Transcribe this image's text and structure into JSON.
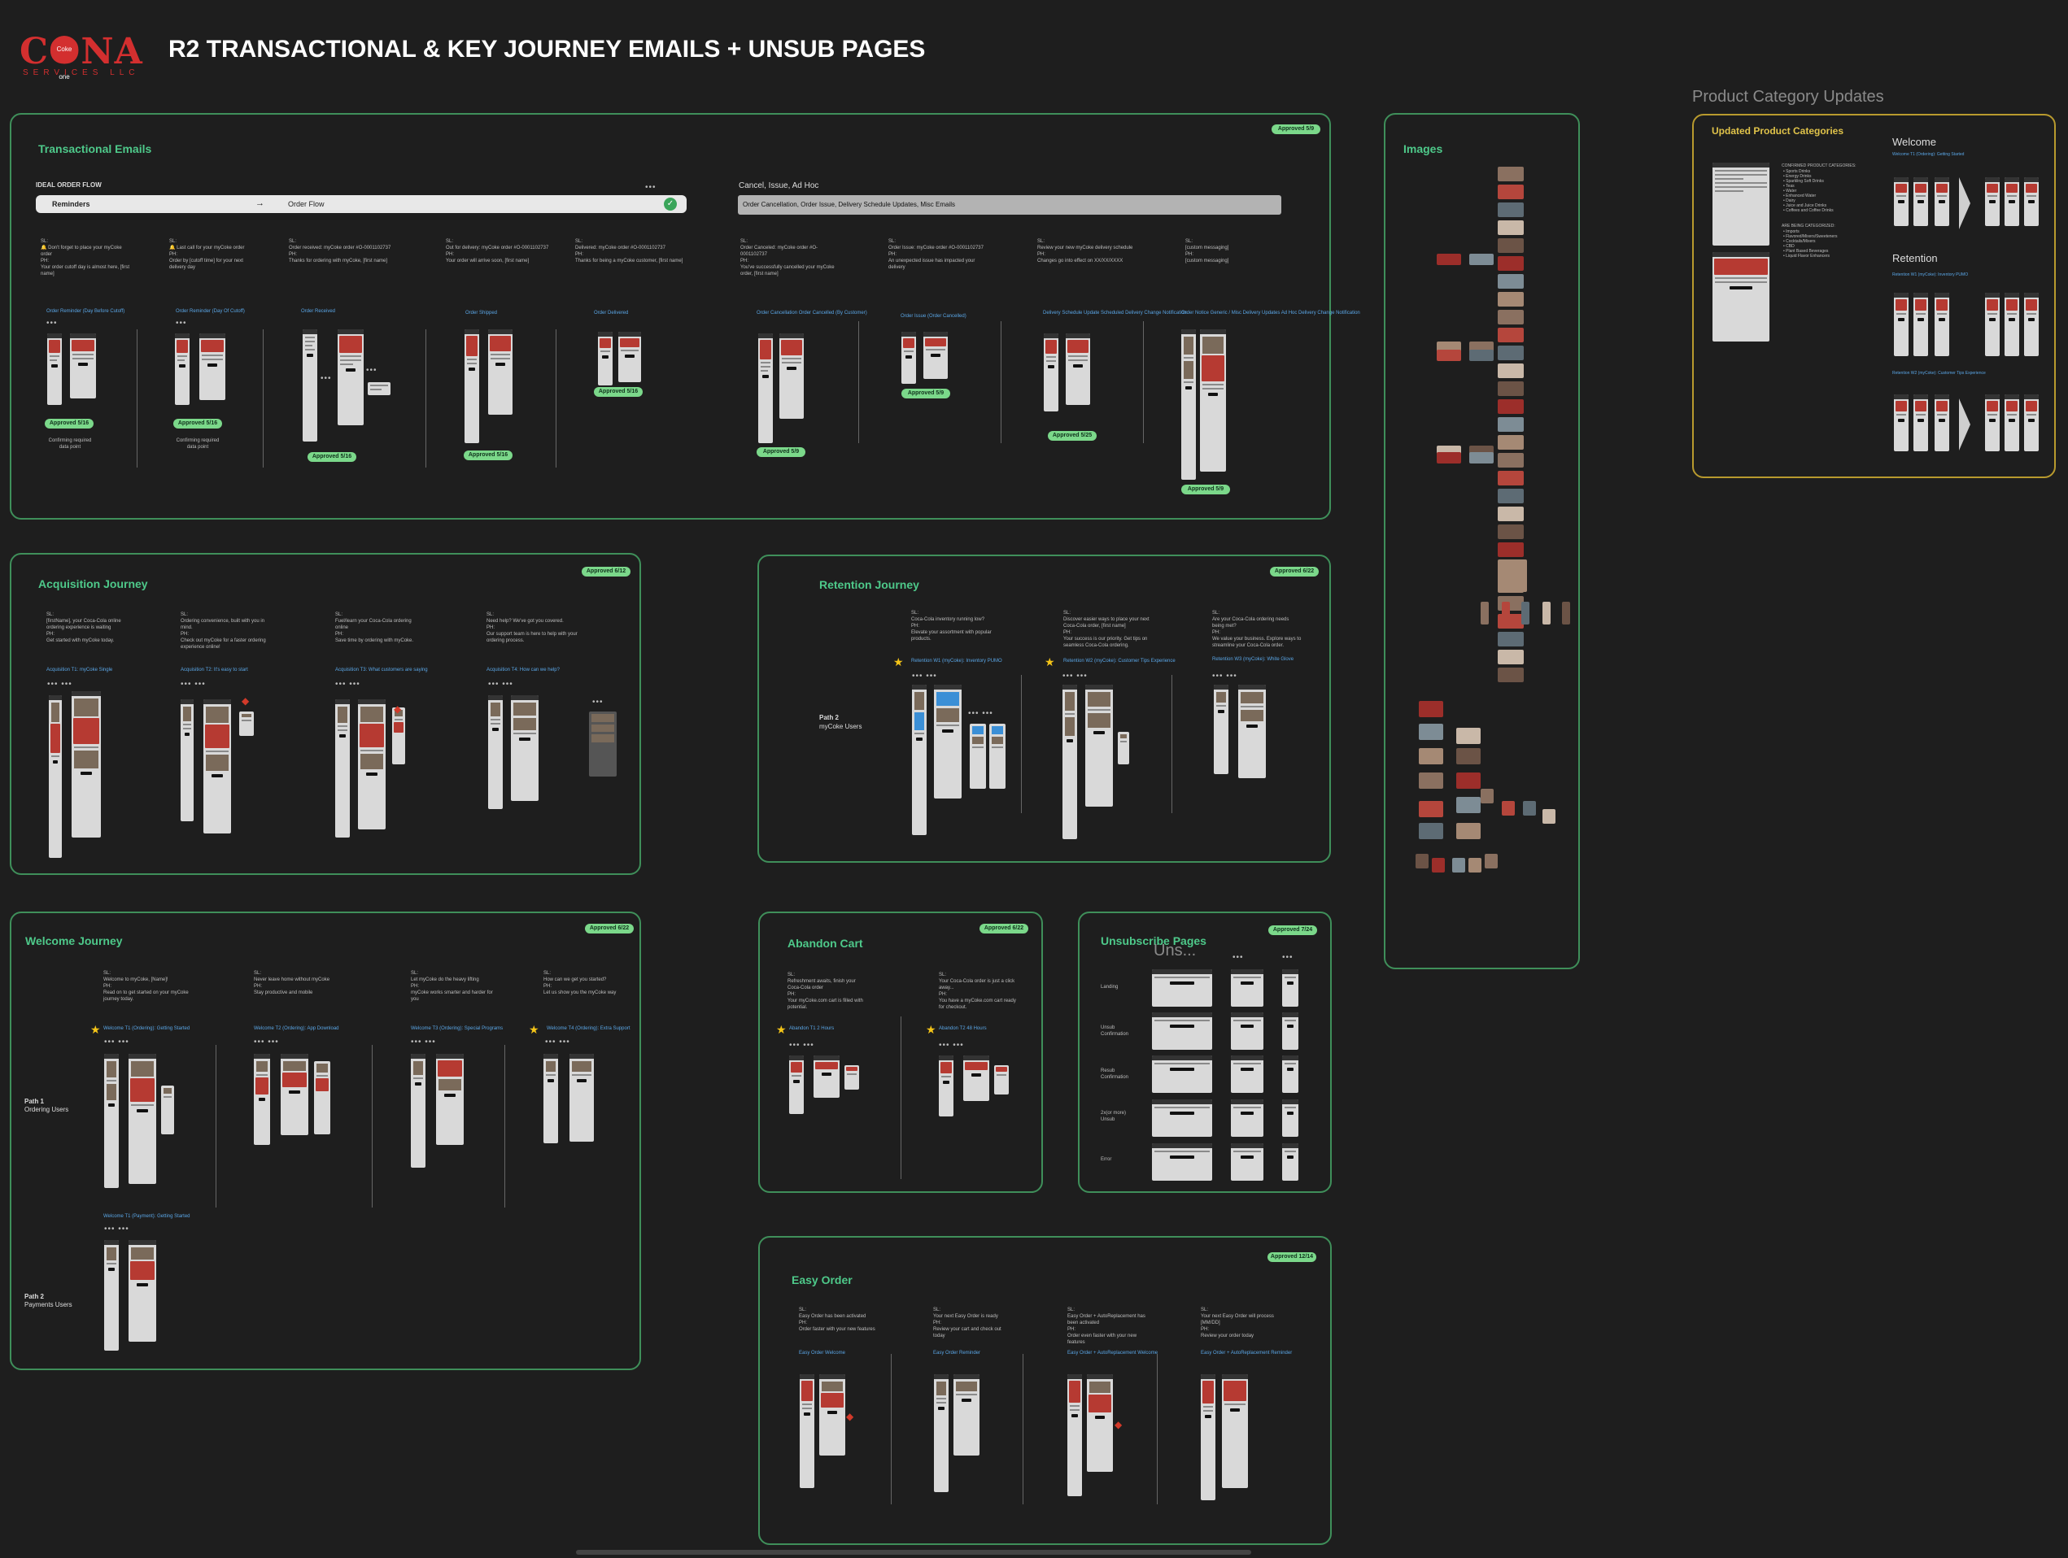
{
  "logo": {
    "brand": "CONA",
    "coke": "Coke one",
    "sub": "SERVICES LLC"
  },
  "header": {
    "title": "R2 TRANSACTIONAL & KEY JOURNEY EMAILS + UNSUB PAGES"
  },
  "transactional": {
    "title": "Transactional Emails",
    "badge": "Approved 5/9",
    "ideal_label": "IDEAL ORDER FLOW",
    "flow": {
      "a": "Reminders",
      "b": "Order Flow"
    },
    "cancel_label": "Cancel, Issue, Ad Hoc",
    "cancel_bar": "Order Cancellation, Order Issue, Delivery Schedule Updates, Misc Emails",
    "columns": [
      {
        "sl": "SL:\n🔔 Don't forget to place your myCoke order\nPH:\nYour order cutoff day is almost here, [first name]",
        "label": "Order Reminder (Day Before Cutoff)",
        "badge": "Approved 5/16",
        "note": "Confirming required data point"
      },
      {
        "sl": "SL:\n🔔 Last call for your myCoke order\nPH:\nOrder by [cutoff time] for your next delivery day",
        "label": "Order Reminder (Day Of Cutoff)",
        "badge": "Approved 5/16",
        "note": "Confirming required data point"
      },
      {
        "sl": "SL:\nOrder received: myCoke order #O-0001102737\nPH:\nThanks for ordering with myCoke, [first name]",
        "label": "Order Received",
        "badge": "Approved 5/16",
        "note": ""
      },
      {
        "sl": "SL:\nOut for delivery: myCoke order #O-0001102737\nPH:\nYour order will arrive soon, [first name]",
        "label": "Order Shipped",
        "badge": "Approved 5/16",
        "note": ""
      },
      {
        "sl": "SL:\nDelivered: myCoke order #O-0001102737\nPH:\nThanks for being a myCoke customer, [first name]",
        "label": "Order Delivered",
        "badge": "Approved 5/16",
        "note": ""
      },
      {
        "sl": "SL:\nOrder Canceled: myCoke order #O-0001102737\nPH:\nYou've successfully cancelled your myCoke order, [first name]",
        "label": "Order Cancellation\nOrder Cancelled (By Customer)",
        "badge": "Approved 5/9",
        "note": ""
      },
      {
        "sl": "SL:\nOrder Issue: myCoke order #O-0001102737\nPH:\nAn unexpected issue has impacted your delivery",
        "label": "Order Issue (Order Cancelled)",
        "badge": "Approved 5/9",
        "note": ""
      },
      {
        "sl": "SL:\nReview your new myCoke delivery schedule\nPH:\nChanges go into effect on XX/XX/XXXX",
        "label": "Delivery Schedule Update\nScheduled Delivery Change Notification",
        "badge": "Approved 5/25",
        "note": ""
      },
      {
        "sl": "SL:\n[custom messaging]\nPH:\n[custom messaging]",
        "label": "Order Notice Generic / Misc Delivery Updates\nAd Hoc Delivery Change Notification",
        "badge": "Approved 5/9",
        "note": ""
      }
    ]
  },
  "acquisition": {
    "title": "Acquisition Journey",
    "badge": "Approved 6/12",
    "columns": [
      {
        "sl": "SL:\n[firstName], your Coca-Cola online ordering experience is waiting\nPH:\nGet started with myCoke today.",
        "label": "Acquisition T1:\nmyCoke Single"
      },
      {
        "sl": "SL:\nOrdering convenience, built with you in mind.\nPH:\nCheck out myCoke for a faster ordering experience online!",
        "label": "Acquisition T2:\nIt's easy to start"
      },
      {
        "sl": "SL:\nFuel/learn your Coca-Cola ordering online\nPH:\nSave time by ordering with myCoke.",
        "label": "Acquisition T3:\nWhat customers are saying"
      },
      {
        "sl": "SL:\nNeed help? We've got you covered.\nPH:\nOur support team is here to help with your ordering process.",
        "label": "Acquisition T4:\nHow can we help?"
      }
    ]
  },
  "retention": {
    "title": "Retention Journey",
    "badge": "Approved 6/22",
    "path_title": "Path 2",
    "path_sub": "myCoke Users",
    "columns": [
      {
        "sl": "SL:\nCoca-Cola inventory running low?\nPH:\nElevate your assortment with popular products.",
        "label": "Retention W1 (myCoke):\nInventory PUMO"
      },
      {
        "sl": "SL:\nDiscover easier ways to place your next Coca-Cola order, [first name]\nPH:\nYour success is our priority. Get tips on seamless Coca-Cola ordering.",
        "label": "Retention W2 (myCoke):\nCustomer Tips Experience"
      },
      {
        "sl": "SL:\nAre your Coca-Cola ordering needs being met?\nPH:\nWe value your business. Explore ways to streamline your Coca-Cola order.",
        "label": "Retention W3 (myCoke):\nWhite Glove"
      }
    ]
  },
  "welcome": {
    "title": "Welcome Journey",
    "badge": "Approved 6/22",
    "path1_title": "Path 1",
    "path1_sub": "Ordering Users",
    "path2_title": "Path 2",
    "path2_sub": "Payments Users",
    "columns": [
      {
        "sl": "SL:\nWelcome to myCoke, [Name]!\nPH:\nRead on to get started on your myCoke journey today.",
        "label": "Welcome T1 (Ordering):\nGetting Started"
      },
      {
        "sl": "SL:\nNever leave home without myCoke\nPH:\nStay productive and mobile",
        "label": "Welcome T2 (Ordering):\nApp Download"
      },
      {
        "sl": "SL:\nLet myCoke do the heavy lifting\nPH:\nmyCoke works smarter and harder for you",
        "label": "Welcome T3 (Ordering):\nSpecial Programs"
      },
      {
        "sl": "SL:\nHow can we get you started?\nPH:\nLet us show you the myCoke way",
        "label": "Welcome T4 (Ordering):\nExtra Support"
      }
    ],
    "path2_label": "Welcome T1 (Payment):\nGetting Started"
  },
  "abandon": {
    "title": "Abandon Cart",
    "badge": "Approved 6/22",
    "columns": [
      {
        "sl": "SL:\nRefreshment awaits, finish your Coca-Cola order\nPH:\nYour myCoke.com cart is filled with potential.",
        "label": "Abandon T1\n2 Hours"
      },
      {
        "sl": "SL:\nYour Coca-Cola order is just a click away...\nPH:\nYou have a myCoke.com cart ready for checkout.",
        "label": "Abandon T2\n48 Hours"
      }
    ]
  },
  "unsub": {
    "title": "Unsubscribe Pages",
    "overlay": "Uns...",
    "badge": "Approved 7/24",
    "rows": [
      "Landing",
      "Unsub\nConfirmation",
      "Resub\nConfirmation",
      "2x(or more)\nUnsub",
      "Error"
    ]
  },
  "easy": {
    "title": "Easy Order",
    "badge": "Approved 12/14",
    "columns": [
      {
        "sl": "SL:\nEasy Order has been activated\nPH:\nOrder faster with your new features",
        "label": "Easy Order Welcome"
      },
      {
        "sl": "SL:\nYour next Easy Order is ready\nPH:\nReview your cart and check out today",
        "label": "Easy Order Reminder"
      },
      {
        "sl": "SL:\nEasy Order + AutoReplacement has been activated\nPH:\nOrder even faster with your new features",
        "label": "Easy Order + AutoReplacement Welcome"
      },
      {
        "sl": "SL:\nYour next Easy Order will process [MM/DD]\nPH:\nReview your order today",
        "label": "Easy Order + AutoReplacement Reminder"
      }
    ]
  },
  "images": {
    "title": "Images"
  },
  "category": {
    "heading": "Product Category Updates",
    "title": "Updated Product Categories",
    "welcome": "Welcome",
    "retention": "Retention",
    "welcome_label": "Welcome T1 (Ordering):\nGetting Started",
    "retention_label1": "Retention W1 (myCoke):\nInventory PUMO",
    "retention_label2": "Retention W2 (myCoke):\nCustomer Tips Experience",
    "confirmed_head": "CONFIRMED PRODUCT CATEGORIES:",
    "confirmed": "• Sports Drinks\n• Energy Drinks\n• Sparkling Soft Drinks\n• Teas\n• Water\n• Enhanced Water\n• Dairy\n• Juice and Juice Drinks\n• Coffees and Coffee Drinks",
    "new_head": "ARE BEING CATEGORIZED:",
    "new": "• Imports\n• Flavored/Mixers/Sweeteners\n• Cocktails/Mixers\n• CBD\n• Plant Based Beverages\n• Liquid Flavor Enhancers"
  },
  "colors": {
    "bg": "#1e1e1e",
    "section_border": "#3f8f5a",
    "section_title": "#4ec98a",
    "badge": "#7bd88a",
    "gold": "#b89a2e",
    "brand_red": "#d32f2f"
  }
}
